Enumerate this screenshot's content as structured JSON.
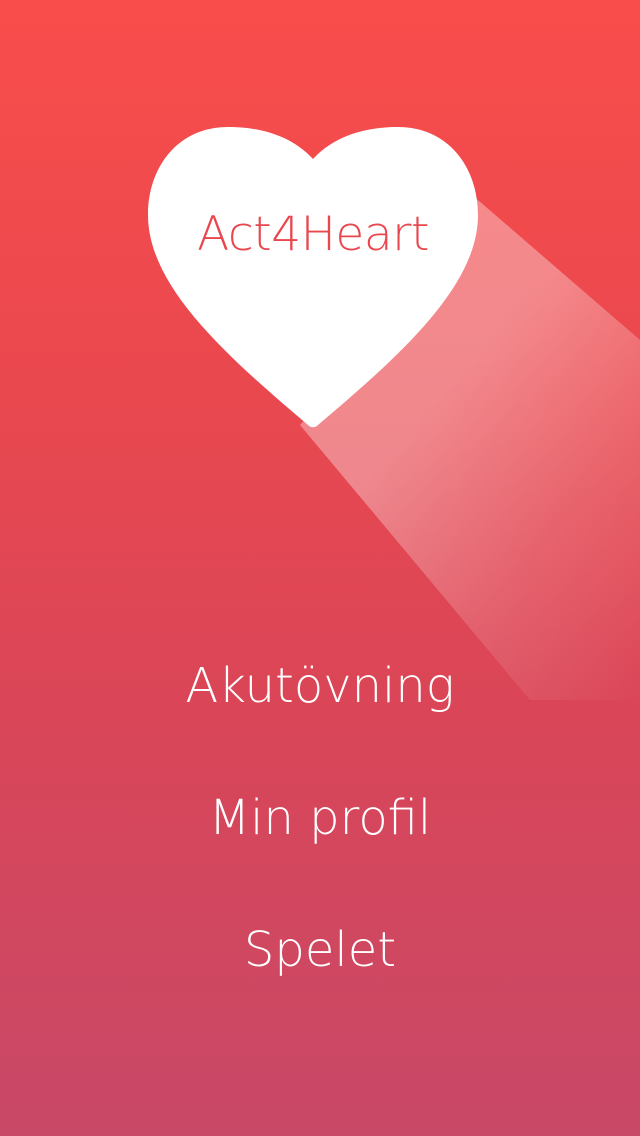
{
  "app": {
    "logo_text": "Act4Heart"
  },
  "menu": {
    "items": [
      {
        "label": "Akutövning"
      },
      {
        "label": "Min profil"
      },
      {
        "label": "Spelet"
      }
    ]
  },
  "colors": {
    "background_top": "#f94d4b",
    "background_bottom": "#c84867",
    "logo_text": "#e8474e",
    "heart_fill": "#ffffff",
    "menu_text": "#ffffff"
  },
  "icons": {
    "logo": "heart-icon"
  }
}
